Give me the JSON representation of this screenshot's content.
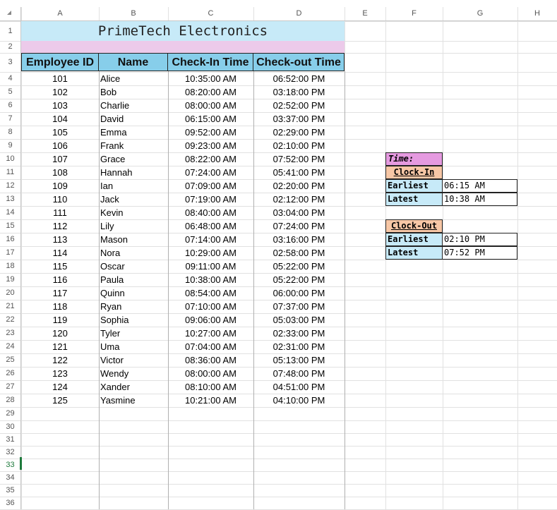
{
  "columns": [
    "A",
    "B",
    "C",
    "D",
    "E",
    "F",
    "G",
    "H"
  ],
  "rows": [
    "1",
    "2",
    "3",
    "4",
    "5",
    "6",
    "7",
    "8",
    "9",
    "10",
    "11",
    "12",
    "13",
    "14",
    "15",
    "16",
    "17",
    "18",
    "19",
    "20",
    "21",
    "22",
    "23",
    "24",
    "25",
    "26",
    "27",
    "28",
    "29",
    "30",
    "31",
    "32",
    "33",
    "34",
    "35",
    "36"
  ],
  "title": "PrimeTech Electronics",
  "headers": [
    "Employee ID",
    "Name",
    "Check-In Time",
    "Check-out Time"
  ],
  "employees": [
    {
      "id": "101",
      "name": "Alice",
      "in": "10:35:00 AM",
      "out": "06:52:00 PM"
    },
    {
      "id": "102",
      "name": "Bob",
      "in": "08:20:00 AM",
      "out": "03:18:00 PM"
    },
    {
      "id": "103",
      "name": "Charlie",
      "in": "08:00:00 AM",
      "out": "02:52:00 PM"
    },
    {
      "id": "104",
      "name": "David",
      "in": "06:15:00 AM",
      "out": "03:37:00 PM"
    },
    {
      "id": "105",
      "name": "Emma",
      "in": "09:52:00 AM",
      "out": "02:29:00 PM"
    },
    {
      "id": "106",
      "name": "Frank",
      "in": "09:23:00 AM",
      "out": "02:10:00 PM"
    },
    {
      "id": "107",
      "name": "Grace",
      "in": "08:22:00 AM",
      "out": "07:52:00 PM"
    },
    {
      "id": "108",
      "name": "Hannah",
      "in": "07:24:00 AM",
      "out": "05:41:00 PM"
    },
    {
      "id": "109",
      "name": "Ian",
      "in": "07:09:00 AM",
      "out": "02:20:00 PM"
    },
    {
      "id": "110",
      "name": "Jack",
      "in": "07:19:00 AM",
      "out": "02:12:00 PM"
    },
    {
      "id": "111",
      "name": "Kevin",
      "in": "08:40:00 AM",
      "out": "03:04:00 PM"
    },
    {
      "id": "112",
      "name": "Lily",
      "in": "06:48:00 AM",
      "out": "07:24:00 PM"
    },
    {
      "id": "113",
      "name": "Mason",
      "in": "07:14:00 AM",
      "out": "03:16:00 PM"
    },
    {
      "id": "114",
      "name": "Nora",
      "in": "10:29:00 AM",
      "out": "02:58:00 PM"
    },
    {
      "id": "115",
      "name": "Oscar",
      "in": "09:11:00 AM",
      "out": "05:22:00 PM"
    },
    {
      "id": "116",
      "name": "Paula",
      "in": "10:38:00 AM",
      "out": "05:22:00 PM"
    },
    {
      "id": "117",
      "name": "Quinn",
      "in": "08:54:00 AM",
      "out": "06:00:00 PM"
    },
    {
      "id": "118",
      "name": "Ryan",
      "in": "07:10:00 AM",
      "out": "07:37:00 PM"
    },
    {
      "id": "119",
      "name": "Sophia",
      "in": "09:06:00 AM",
      "out": "05:03:00 PM"
    },
    {
      "id": "120",
      "name": "Tyler",
      "in": "10:27:00 AM",
      "out": "02:33:00 PM"
    },
    {
      "id": "121",
      "name": "Uma",
      "in": "07:04:00 AM",
      "out": "02:31:00 PM"
    },
    {
      "id": "122",
      "name": "Victor",
      "in": "08:36:00 AM",
      "out": "05:13:00 PM"
    },
    {
      "id": "123",
      "name": "Wendy",
      "in": "08:00:00 AM",
      "out": "07:48:00 PM"
    },
    {
      "id": "124",
      "name": "Xander",
      "in": "08:10:00 AM",
      "out": "04:51:00 PM"
    },
    {
      "id": "125",
      "name": "Yasmine",
      "in": "10:21:00 AM",
      "out": "04:10:00 PM"
    }
  ],
  "summary": {
    "time_label": "Time:",
    "clock_in": {
      "label": "Clock-In",
      "earliest_label": "Earliest",
      "earliest": "06:15 AM",
      "latest_label": "Latest",
      "latest": "10:38 AM"
    },
    "clock_out": {
      "label": "Clock-Out",
      "earliest_label": "Earliest",
      "earliest": "02:10 PM",
      "latest_label": "Latest",
      "latest": "07:52 PM"
    }
  },
  "colors": {
    "title_bg": "#c7eaf8",
    "band_bg": "#eccaea",
    "header_bg": "#87ceea",
    "time_bg": "#e59ae0",
    "section_bg": "#f7c7a6"
  }
}
